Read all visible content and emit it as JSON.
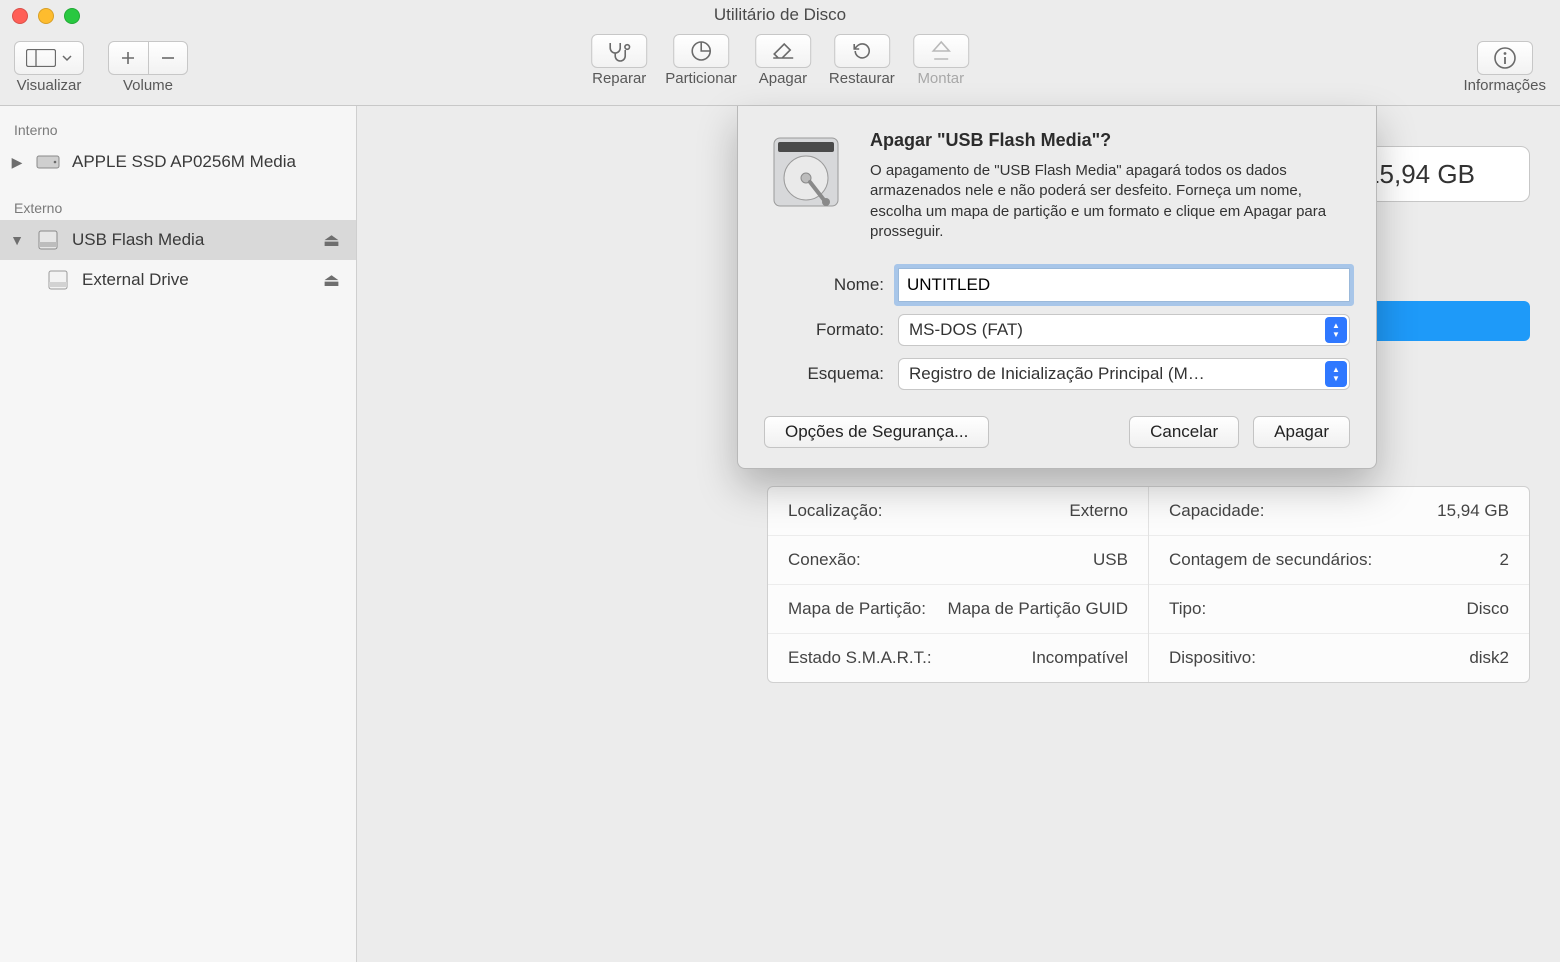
{
  "window": {
    "title": "Utilitário de Disco"
  },
  "toolbar": {
    "view_label": "Visualizar",
    "volume_label": "Volume",
    "firstaid_label": "Reparar",
    "partition_label": "Particionar",
    "erase_label": "Apagar",
    "restore_label": "Restaurar",
    "mount_label": "Montar",
    "info_label": "Informações"
  },
  "sidebar": {
    "internal_header": "Interno",
    "external_header": "Externo",
    "internal_items": [
      {
        "label": "APPLE SSD AP0256M Media"
      }
    ],
    "external_items": [
      {
        "label": "USB Flash Media"
      },
      {
        "label": "External Drive"
      }
    ]
  },
  "capacity_badge": "15,94 GB",
  "info": {
    "left": [
      {
        "k": "Localização:",
        "v": "Externo"
      },
      {
        "k": "Conexão:",
        "v": "USB"
      },
      {
        "k": "Mapa de Partição:",
        "v": "Mapa de Partição GUID"
      },
      {
        "k": "Estado S.M.A.R.T.:",
        "v": "Incompatível"
      }
    ],
    "right": [
      {
        "k": "Capacidade:",
        "v": "15,94 GB"
      },
      {
        "k": "Contagem de secundários:",
        "v": "2"
      },
      {
        "k": "Tipo:",
        "v": "Disco"
      },
      {
        "k": "Dispositivo:",
        "v": "disk2"
      }
    ]
  },
  "sheet": {
    "title": "Apagar \"USB Flash Media\"?",
    "description": "O apagamento de \"USB Flash Media\" apagará todos os dados armazenados nele e não poderá ser desfeito. Forneça um nome, escolha um mapa de partição e um formato e clique em Apagar para prosseguir.",
    "name_label": "Nome:",
    "name_value": "UNTITLED",
    "format_label": "Formato:",
    "format_value": "MS-DOS (FAT)",
    "scheme_label": "Esquema:",
    "scheme_value": "Registro de Inicialização Principal (M…",
    "security_button": "Opções de Segurança...",
    "cancel_button": "Cancelar",
    "erase_button": "Apagar"
  }
}
